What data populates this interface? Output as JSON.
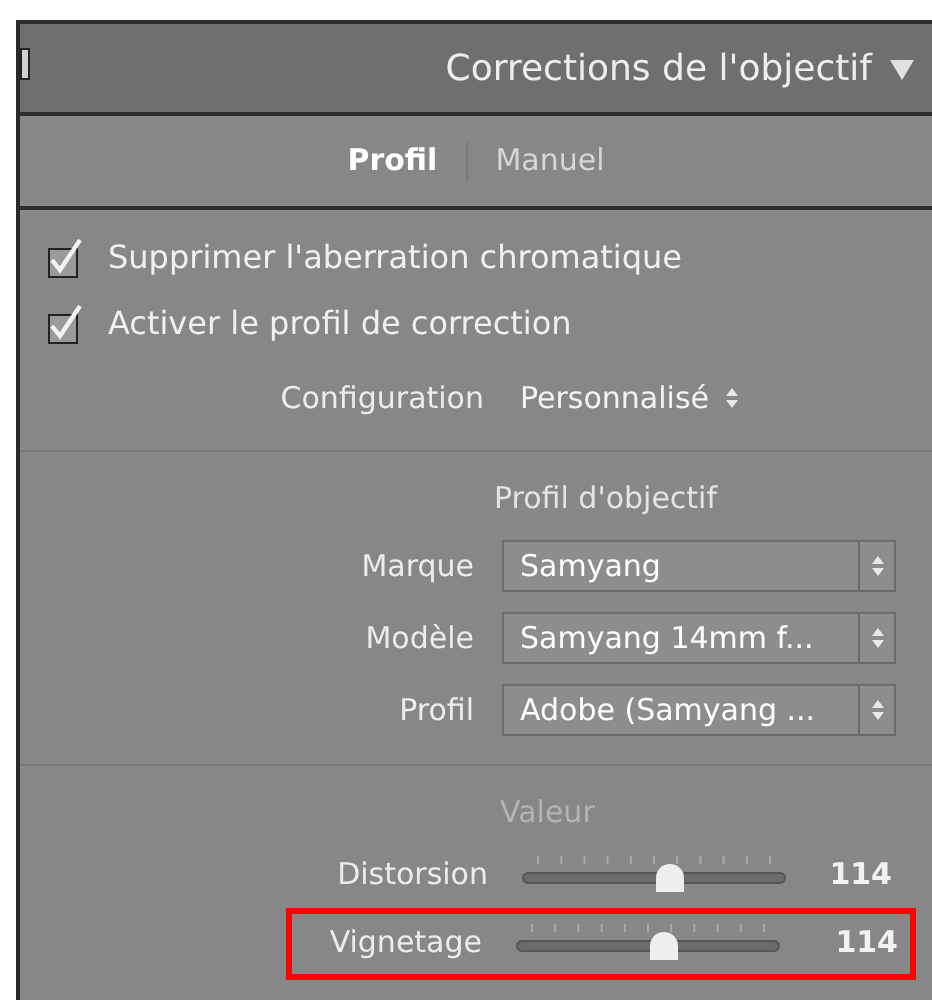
{
  "panel": {
    "title": "Corrections de l'objectif",
    "expanded": true
  },
  "tabs": [
    {
      "label": "Profil",
      "selected": true
    },
    {
      "label": "Manuel",
      "selected": false
    }
  ],
  "options": [
    {
      "label": "Supprimer l'aberration chromatique",
      "checked": true
    },
    {
      "label": "Activer le profil de correction",
      "checked": true
    }
  ],
  "setup": {
    "label": "Configuration",
    "value": "Personnalisé"
  },
  "lens_profile": {
    "heading": "Profil d'objectif",
    "fields": [
      {
        "label": "Marque",
        "value": "Samyang"
      },
      {
        "label": "Modèle",
        "value": "Samyang 14mm f..."
      },
      {
        "label": "Profil",
        "value": "Adobe (Samyang ..."
      }
    ]
  },
  "amount": {
    "heading": "Valeur",
    "sliders": [
      {
        "label": "Distorsion",
        "level": 0.56,
        "reading": "114",
        "highlighted": false
      },
      {
        "label": "Vignetage",
        "level": 0.56,
        "reading": "114",
        "highlighted": true
      }
    ]
  }
}
